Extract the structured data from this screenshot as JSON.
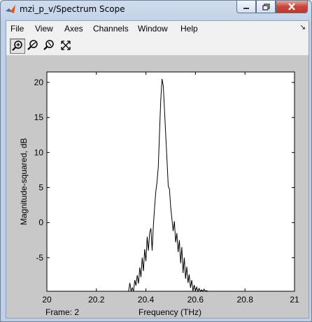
{
  "window": {
    "title": "mzi_p_v/Spectrum Scope"
  },
  "menu": [
    "File",
    "View",
    "Axes",
    "Channels",
    "Window",
    "Help"
  ],
  "toolbar": [
    "zoom-in-icon",
    "zoom-x-icon",
    "zoom-y-icon",
    "autoscale-icon"
  ],
  "status": {
    "frame": "Frame: 2"
  },
  "chart_data": {
    "type": "line",
    "xlabel": "Frequency (THz)",
    "ylabel": "Magnitude-squared, dB",
    "xlim": [
      20,
      21
    ],
    "ylim": [
      -9.8,
      21.5
    ],
    "xticks": [
      "20",
      "20.2",
      "20.4",
      "20.6",
      "20.8",
      "21"
    ],
    "yticks": [
      "20",
      "15",
      "10",
      "5",
      "0",
      "-5"
    ],
    "grid": false,
    "series": [
      {
        "x": [
          20.33,
          20.335,
          20.34,
          20.345,
          20.35,
          20.355,
          20.36,
          20.365,
          20.37,
          20.375,
          20.38,
          20.385,
          20.39,
          20.395,
          20.4,
          20.405,
          20.41,
          20.415,
          20.42,
          20.425,
          20.43,
          20.435,
          20.44,
          20.445,
          20.45,
          20.455,
          20.46,
          20.465,
          20.47,
          20.475,
          20.48,
          20.485,
          20.49,
          20.495,
          20.5,
          20.505,
          20.51,
          20.515,
          20.52,
          20.525,
          20.53,
          20.535,
          20.54,
          20.545,
          20.55,
          20.555,
          20.56,
          20.565,
          20.57,
          20.575,
          20.58,
          20.585,
          20.59,
          20.595,
          20.6,
          20.605,
          20.61,
          20.615,
          20.62,
          20.625,
          20.63,
          20.635,
          20.64,
          20.645,
          20.65
        ],
        "y": [
          -9.8,
          -8.6,
          -9.8,
          -9.3,
          -9.8,
          -8.2,
          -9.0,
          -7.5,
          -8.7,
          -6.4,
          -7.8,
          -5.0,
          -6.9,
          -3.8,
          -5.5,
          -2.0,
          -4.0,
          -1.5,
          -0.8,
          -4.0,
          -0.5,
          2.2,
          4.5,
          5.8,
          8.0,
          13.0,
          17.5,
          20.5,
          19.5,
          16.0,
          12.5,
          9.0,
          5.2,
          4.8,
          2.2,
          0.5,
          -1.2,
          0.2,
          -2.8,
          -1.5,
          -4.2,
          -2.5,
          -5.8,
          -3.5,
          -7.2,
          -5.0,
          -8.0,
          -6.3,
          -8.6,
          -7.4,
          -9.3,
          -8.2,
          -9.8,
          -8.9,
          -9.8,
          -9.2,
          -9.8,
          -9.4,
          -9.8,
          -9.6,
          -9.8,
          -9.5,
          -9.8,
          -9.7,
          -9.8
        ]
      }
    ]
  }
}
